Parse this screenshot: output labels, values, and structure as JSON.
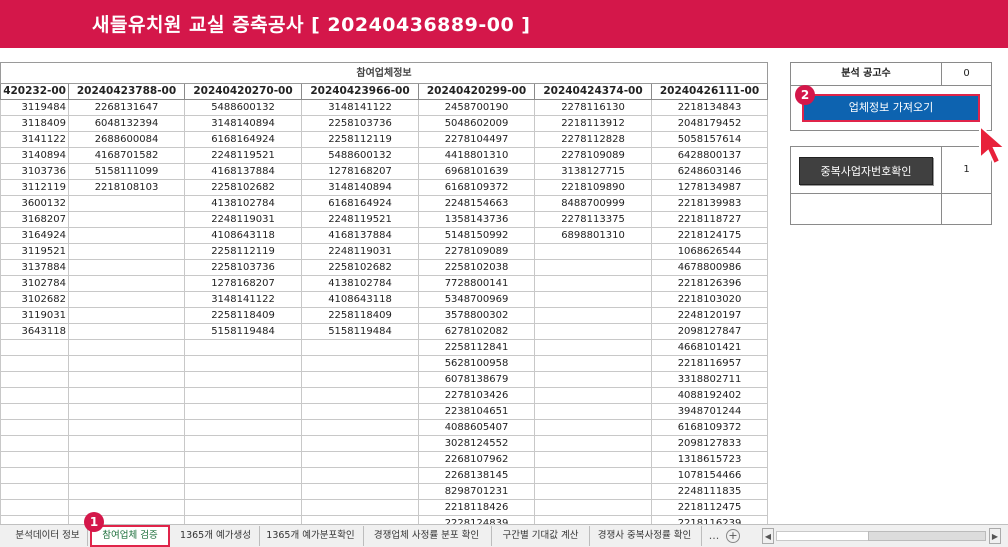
{
  "banner": {
    "title": "새들유치원 교실 증축공사 [ 20240436889-00 ]"
  },
  "table": {
    "group_header": "참여업체정보",
    "columns": [
      "420232-00",
      "20240423788-00",
      "20240420270-00",
      "20240423966-00",
      "20240420299-00",
      "20240424374-00",
      "20240426111-00"
    ],
    "col0": [
      "3119484",
      "3118409",
      "3141122",
      "3140894",
      "3103736",
      "3112119",
      "3600132",
      "3168207",
      "3164924",
      "3119521",
      "3137884",
      "3102784",
      "3102682",
      "3119031",
      "3643118"
    ],
    "col1": [
      "2268131647",
      "6048132394",
      "2688600084",
      "4168701582",
      "5158111099",
      "2218108103"
    ],
    "col2": [
      "5488600132",
      "3148140894",
      "6168164924",
      "2248119521",
      "4168137884",
      "2258102682",
      "4138102784",
      "2248119031",
      "4108643118",
      "2258112119",
      "2258103736",
      "1278168207",
      "3148141122",
      "2258118409",
      "5158119484"
    ],
    "col3": [
      "3148141122",
      "2258103736",
      "2258112119",
      "5488600132",
      "1278168207",
      "3148140894",
      "6168164924",
      "2248119521",
      "4168137884",
      "2248119031",
      "2258102682",
      "4138102784",
      "4108643118",
      "2258118409",
      "5158119484"
    ],
    "col4": [
      "2458700190",
      "5048602009",
      "2278104497",
      "4418801310",
      "6968101639",
      "6168109372",
      "2248154663",
      "1358143736",
      "5148150992",
      "2278109089",
      "2258102038",
      "7728800141",
      "5348700969",
      "3578800302",
      "6278102082",
      "2258112841",
      "5628100958",
      "6078138679",
      "2278103426",
      "2238104651",
      "4088605407",
      "3028124552",
      "2268107962",
      "2268138145",
      "8298701231",
      "2218118426",
      "2228124839"
    ],
    "col5": [
      "2278116130",
      "2218113912",
      "2278112828",
      "2278109089",
      "3138127715",
      "2218109890",
      "8488700999",
      "2278113375",
      "6898801310"
    ],
    "col6": [
      "2218134843",
      "2048179452",
      "5058157614",
      "6428800137",
      "6248603146",
      "1278134987",
      "2218139983",
      "2218118727",
      "2218124175",
      "1068626544",
      "4678800986",
      "2218126396",
      "2218103020",
      "2248120197",
      "2098127847",
      "4668101421",
      "2218116957",
      "3318802711",
      "4088192402",
      "3948701244",
      "6168109372",
      "2098127833",
      "1318615723",
      "1078154466",
      "2248111835",
      "2218112475",
      "2218116239"
    ]
  },
  "panel": {
    "count_label": "분석 공고수",
    "count_value": "0",
    "fetch_button_label": "업체정보 가져오기",
    "dup_button_label": "중복사업자번호확인",
    "dup_value": "1"
  },
  "steps": {
    "step1": "1",
    "step2": "2"
  },
  "sheet_tabs": [
    {
      "label": "분석데이터 정보",
      "active": false
    },
    {
      "label": "참여업체 검증",
      "active": true
    },
    {
      "label": "1365개 예가생성",
      "active": false
    },
    {
      "label": "1365개 예가분포확인",
      "active": false
    },
    {
      "label": "경쟁업체 사정률 분포 확인",
      "active": false
    },
    {
      "label": "구간별 기대값 계산",
      "active": false
    },
    {
      "label": "경쟁사 중복사정률 확인",
      "active": false
    }
  ],
  "tab_controls": {
    "more": "...",
    "add": "+",
    "scroll_left": "◀",
    "scroll_right": "▶"
  },
  "colors": {
    "brand": "#d4174a",
    "fetch_button": "#0d63b0",
    "dup_button": "#404040",
    "highlight": "#e0244a"
  },
  "icons": {
    "cursor": "cursor-arrow-icon",
    "add": "plus-circle-icon"
  }
}
